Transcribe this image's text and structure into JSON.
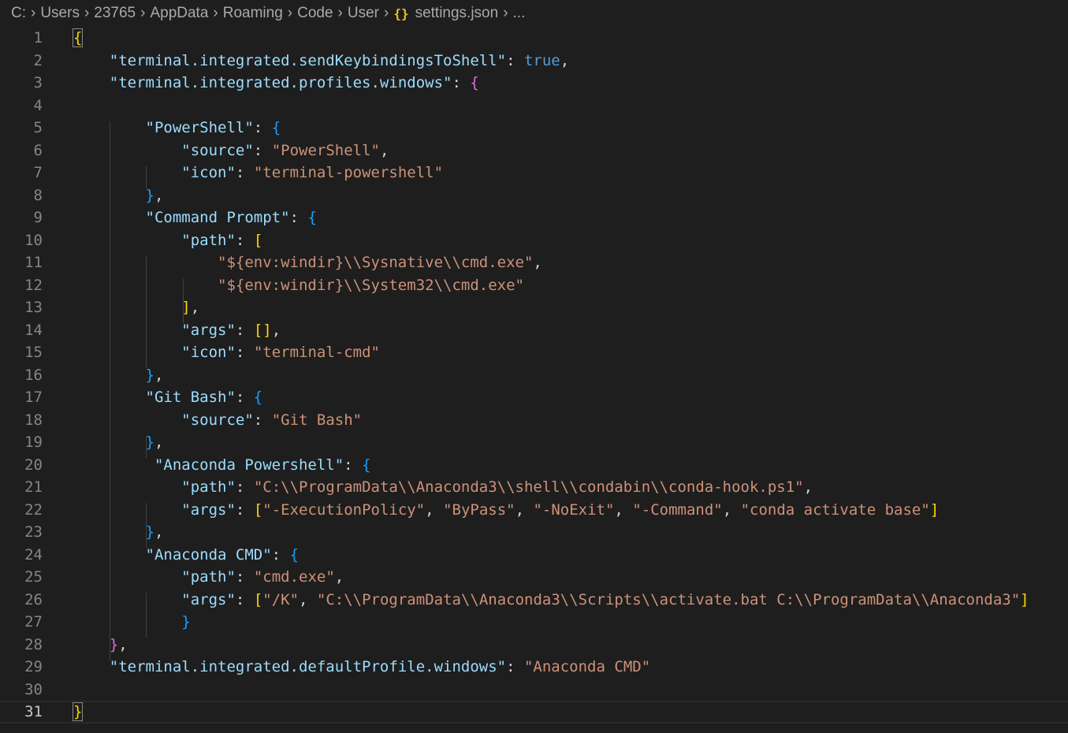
{
  "breadcrumb": {
    "items": [
      "C:",
      "Users",
      "23765",
      "AppData",
      "Roaming",
      "Code",
      "User"
    ],
    "file_icon": "{}",
    "file": "settings.json",
    "more": "..."
  },
  "editor": {
    "current_line": 31,
    "lines": [
      {
        "n": "1",
        "indent": 0,
        "t": [
          [
            "br1",
            "{"
          ]
        ]
      },
      {
        "n": "2",
        "indent": 1,
        "t": [
          [
            "k",
            "\"terminal.integrated.sendKeybindingsToShell\""
          ],
          [
            "p",
            ": "
          ],
          [
            "b",
            "true"
          ],
          [
            "p",
            ","
          ]
        ]
      },
      {
        "n": "3",
        "indent": 1,
        "t": [
          [
            "k",
            "\"terminal.integrated.profiles.windows\""
          ],
          [
            "p",
            ": "
          ],
          [
            "br2",
            "{"
          ]
        ]
      },
      {
        "n": "4",
        "indent": 0,
        "t": []
      },
      {
        "n": "5",
        "indent": 2,
        "t": [
          [
            "k",
            "\"PowerShell\""
          ],
          [
            "p",
            ": "
          ],
          [
            "br3",
            "{"
          ]
        ]
      },
      {
        "n": "6",
        "indent": 3,
        "t": [
          [
            "k",
            "\"source\""
          ],
          [
            "p",
            ": "
          ],
          [
            "s",
            "\"PowerShell\""
          ],
          [
            "p",
            ","
          ]
        ]
      },
      {
        "n": "7",
        "indent": 3,
        "t": [
          [
            "k",
            "\"icon\""
          ],
          [
            "p",
            ": "
          ],
          [
            "s",
            "\"terminal-powershell\""
          ]
        ]
      },
      {
        "n": "8",
        "indent": 2,
        "t": [
          [
            "br3",
            "}"
          ],
          [
            "p",
            ","
          ]
        ]
      },
      {
        "n": "9",
        "indent": 2,
        "t": [
          [
            "k",
            "\"Command Prompt\""
          ],
          [
            "p",
            ": "
          ],
          [
            "br3",
            "{"
          ]
        ]
      },
      {
        "n": "10",
        "indent": 3,
        "t": [
          [
            "k",
            "\"path\""
          ],
          [
            "p",
            ": "
          ],
          [
            "br1",
            "["
          ]
        ]
      },
      {
        "n": "11",
        "indent": 4,
        "t": [
          [
            "s",
            "\"${env:windir}\\\\Sysnative\\\\cmd.exe\""
          ],
          [
            "p",
            ","
          ]
        ]
      },
      {
        "n": "12",
        "indent": 4,
        "t": [
          [
            "s",
            "\"${env:windir}\\\\System32\\\\cmd.exe\""
          ]
        ]
      },
      {
        "n": "13",
        "indent": 3,
        "t": [
          [
            "br1",
            "]"
          ],
          [
            "p",
            ","
          ]
        ]
      },
      {
        "n": "14",
        "indent": 3,
        "t": [
          [
            "k",
            "\"args\""
          ],
          [
            "p",
            ": "
          ],
          [
            "br1",
            "[]"
          ],
          [
            "p",
            ","
          ]
        ]
      },
      {
        "n": "15",
        "indent": 3,
        "t": [
          [
            "k",
            "\"icon\""
          ],
          [
            "p",
            ": "
          ],
          [
            "s",
            "\"terminal-cmd\""
          ]
        ]
      },
      {
        "n": "16",
        "indent": 2,
        "t": [
          [
            "br3",
            "}"
          ],
          [
            "p",
            ","
          ]
        ]
      },
      {
        "n": "17",
        "indent": 2,
        "t": [
          [
            "k",
            "\"Git Bash\""
          ],
          [
            "p",
            ": "
          ],
          [
            "br3",
            "{"
          ]
        ]
      },
      {
        "n": "18",
        "indent": 3,
        "t": [
          [
            "k",
            "\"source\""
          ],
          [
            "p",
            ": "
          ],
          [
            "s",
            "\"Git Bash\""
          ]
        ]
      },
      {
        "n": "19",
        "indent": 2,
        "t": [
          [
            "br3",
            "}"
          ],
          [
            "p",
            ","
          ]
        ]
      },
      {
        "n": "20",
        "indent": 2,
        "pre": " ",
        "t": [
          [
            "k",
            "\"Anaconda Powershell\""
          ],
          [
            "p",
            ": "
          ],
          [
            "br3",
            "{"
          ]
        ]
      },
      {
        "n": "21",
        "indent": 3,
        "t": [
          [
            "k",
            "\"path\""
          ],
          [
            "p",
            ": "
          ],
          [
            "s",
            "\"C:\\\\ProgramData\\\\Anaconda3\\\\shell\\\\condabin\\\\conda-hook.ps1\""
          ],
          [
            "p",
            ","
          ]
        ]
      },
      {
        "n": "22",
        "indent": 3,
        "t": [
          [
            "k",
            "\"args\""
          ],
          [
            "p",
            ": "
          ],
          [
            "br1",
            "["
          ],
          [
            "s",
            "\"-ExecutionPolicy\""
          ],
          [
            "p",
            ", "
          ],
          [
            "s",
            "\"ByPass\""
          ],
          [
            "p",
            ", "
          ],
          [
            "s",
            "\"-NoExit\""
          ],
          [
            "p",
            ", "
          ],
          [
            "s",
            "\"-Command\""
          ],
          [
            "p",
            ", "
          ],
          [
            "s",
            "\"conda activate base\""
          ],
          [
            "br1",
            "]"
          ]
        ]
      },
      {
        "n": "23",
        "indent": 2,
        "t": [
          [
            "br3",
            "}"
          ],
          [
            "p",
            ","
          ]
        ]
      },
      {
        "n": "24",
        "indent": 2,
        "t": [
          [
            "k",
            "\"Anaconda CMD\""
          ],
          [
            "p",
            ": "
          ],
          [
            "br3",
            "{"
          ]
        ]
      },
      {
        "n": "25",
        "indent": 3,
        "t": [
          [
            "k",
            "\"path\""
          ],
          [
            "p",
            ": "
          ],
          [
            "s",
            "\"cmd.exe\""
          ],
          [
            "p",
            ","
          ]
        ]
      },
      {
        "n": "26",
        "indent": 3,
        "t": [
          [
            "k",
            "\"args\""
          ],
          [
            "p",
            ": "
          ],
          [
            "br1",
            "["
          ],
          [
            "s",
            "\"/K\""
          ],
          [
            "p",
            ", "
          ],
          [
            "s",
            "\"C:\\\\ProgramData\\\\Anaconda3\\\\Scripts\\\\activate.bat C:\\\\ProgramData\\\\Anaconda3\""
          ],
          [
            "br1",
            "]"
          ]
        ]
      },
      {
        "n": "27",
        "indent": 3,
        "t": [
          [
            "br3",
            "}"
          ]
        ]
      },
      {
        "n": "28",
        "indent": 1,
        "t": [
          [
            "br2",
            "}"
          ],
          [
            "p",
            ","
          ]
        ]
      },
      {
        "n": "29",
        "indent": 1,
        "t": [
          [
            "k",
            "\"terminal.integrated.defaultProfile.windows\""
          ],
          [
            "p",
            ": "
          ],
          [
            "s",
            "\"Anaconda CMD\""
          ]
        ]
      },
      {
        "n": "30",
        "indent": 0,
        "t": []
      },
      {
        "n": "31",
        "indent": 0,
        "t": [
          [
            "br1",
            "}"
          ]
        ]
      }
    ]
  },
  "colors": {
    "background": "#1e1e1e",
    "key": "#9cdcfe",
    "string": "#ce9178",
    "boolean": "#569cd6",
    "bracket_level1": "#ffd700",
    "bracket_level2": "#da70d6",
    "bracket_level3": "#179fff"
  }
}
